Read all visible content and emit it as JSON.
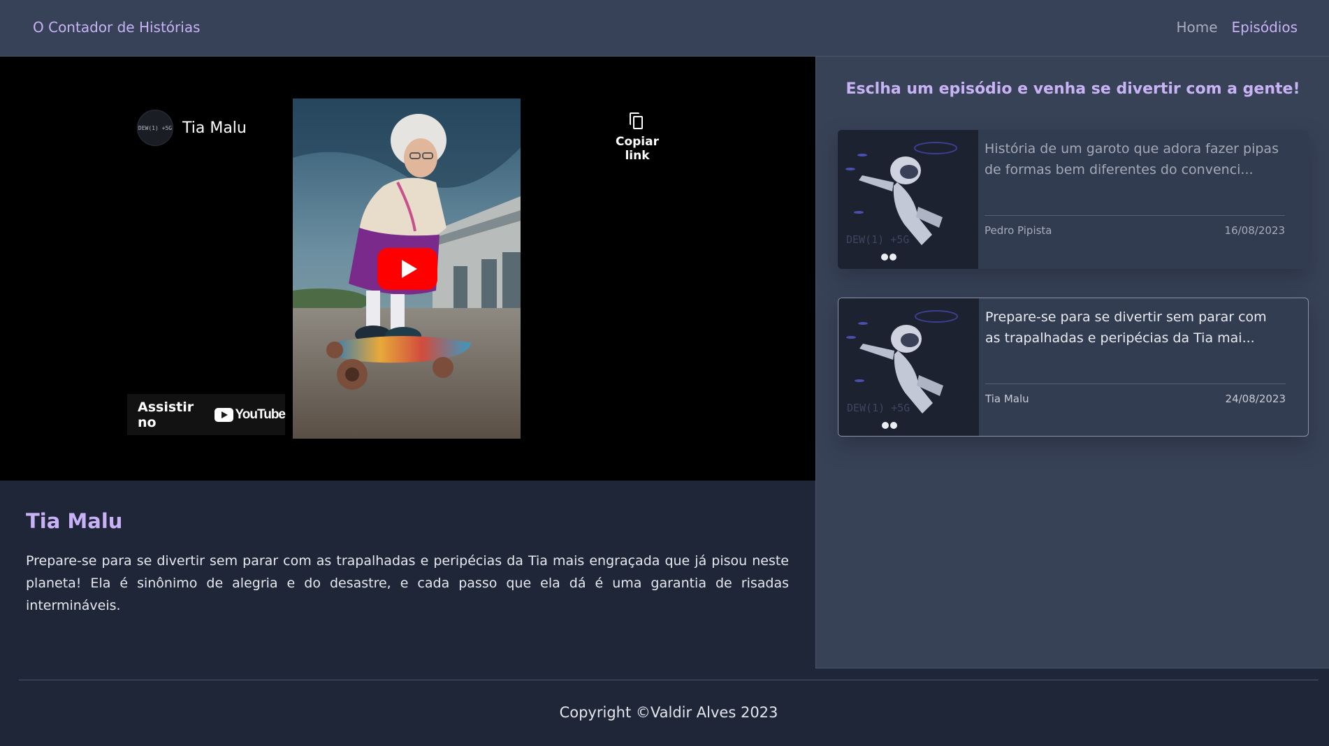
{
  "header": {
    "brand": "O Contador de Histórias",
    "nav": [
      {
        "label": "Home",
        "active": false
      },
      {
        "label": "Episódios",
        "active": true
      }
    ]
  },
  "player": {
    "channel_name": "Tia Malu",
    "avatar_text": "DEW(1) +5G",
    "copy_link_label": "Copiar link",
    "watch_on_label": "Assistir no",
    "youtube_wordmark": "YouTube"
  },
  "episode": {
    "title": "Tia Malu",
    "description": "Prepare-se para se divertir sem parar com as trapalhadas e peripécias da Tia mais engraçada que já pisou neste planeta! Ela é sinônimo de alegria e do desastre, e cada passo que ela dá é uma garantia de risadas intermináveis."
  },
  "sidebar": {
    "heading": "Esclha um episódio e venha se divertir com a gente!",
    "episodes": [
      {
        "excerpt": "História de um garoto que adora fazer pipas de formas bem diferentes do convenci...",
        "author": "Pedro Pipista",
        "date": "16/08/2023",
        "thumb_text": "DEW(1) +5G",
        "selected": false
      },
      {
        "excerpt": "Prepare-se para se divertir sem parar com as trapalhadas e peripécias da Tia mai...",
        "author": "Tia Malu",
        "date": "24/08/2023",
        "thumb_text": "DEW(1) +5G",
        "selected": true
      }
    ]
  },
  "footer": {
    "copyright": "Copyright ©Valdir Alves 2023"
  },
  "colors": {
    "accent": "#c8b3f4",
    "youtube_red": "#ff0000",
    "header_bg": "#374258",
    "body_bg": "#1e2637"
  }
}
